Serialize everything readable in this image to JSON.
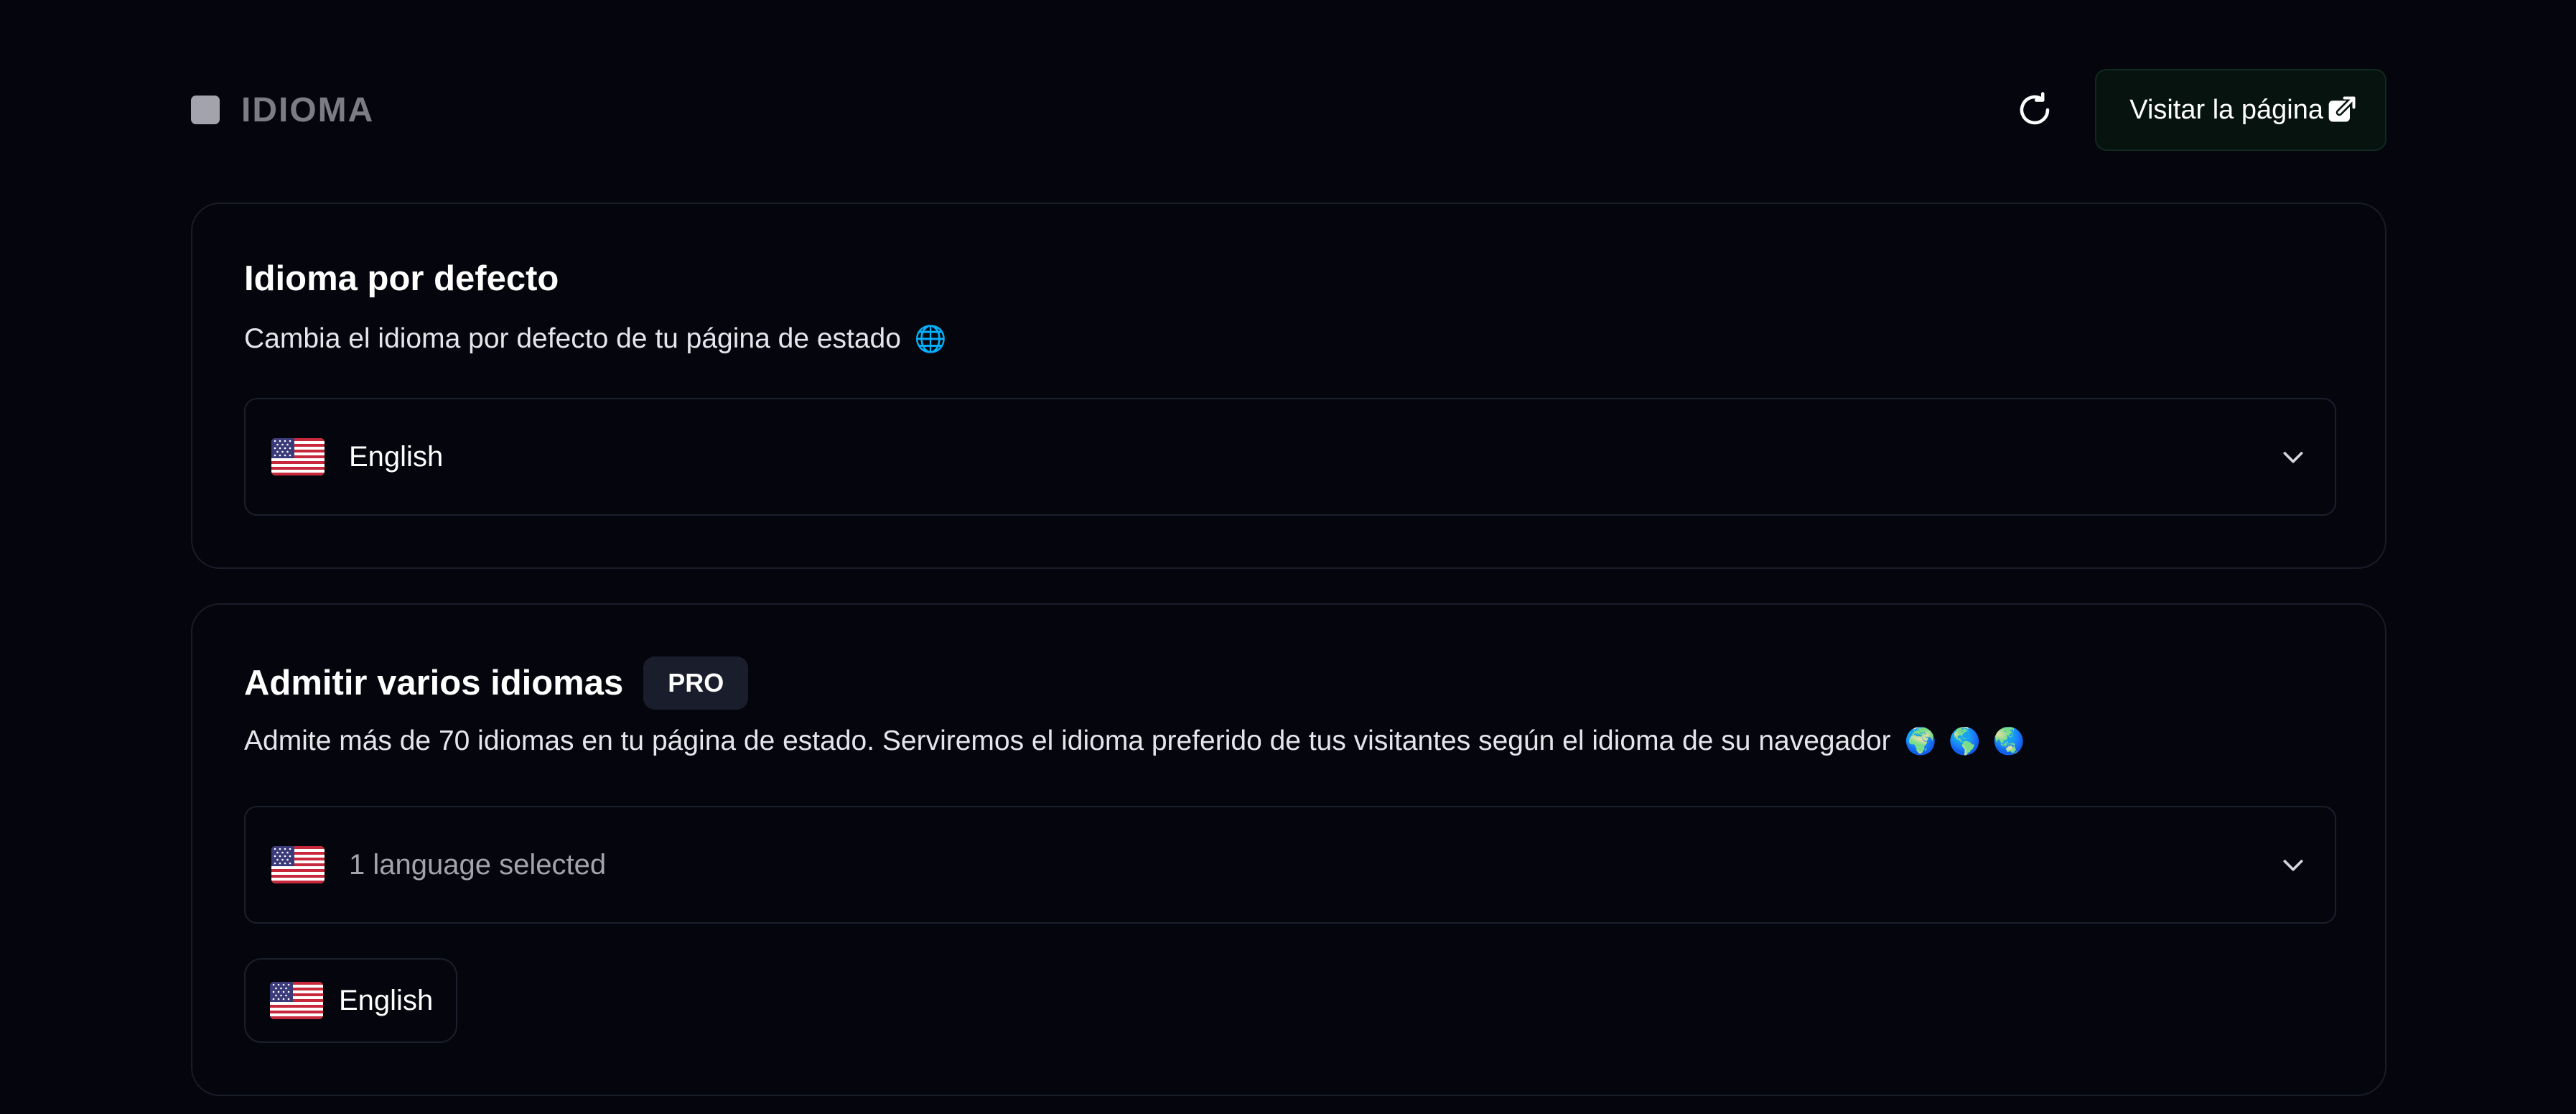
{
  "header": {
    "title": "IDIOMA",
    "visit_label": "Visitar la página"
  },
  "icons": {
    "square": "square-icon",
    "refresh": "refresh-icon",
    "external_link": "external-link-icon",
    "chevron": "chevron-down-icon",
    "flag": "us-flag-icon"
  },
  "default_language": {
    "title": "Idioma por defecto",
    "description": "Cambia el idioma por defecto de tu página de estado",
    "description_emoji": "🌐",
    "selected": "English"
  },
  "multi_language": {
    "title": "Admitir varios idiomas",
    "badge": "PRO",
    "description": "Admite más de 70 idiomas en tu página de estado. Serviremos el idioma preferido de tus visitantes según el idioma de su navegador",
    "description_emojis": [
      "🌍",
      "🌎",
      "🌏"
    ],
    "select_summary": "1 language selected",
    "chips": [
      {
        "label": "English"
      }
    ]
  },
  "colors": {
    "background": "#05060d",
    "card_border": "#191c29",
    "visit_button_bg": "#06130f",
    "muted_text": "#7b7c86"
  }
}
